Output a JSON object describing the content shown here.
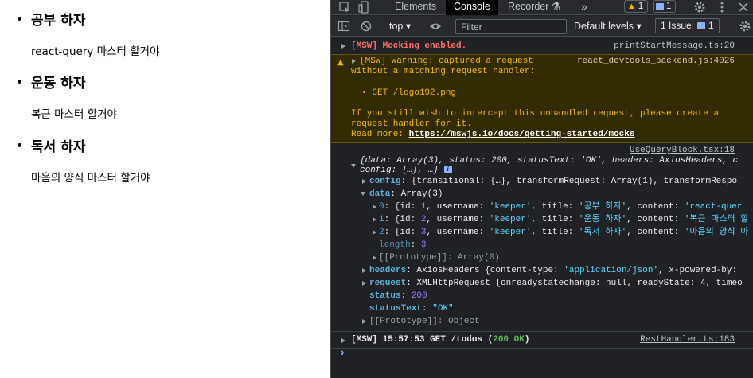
{
  "todos": [
    {
      "title": "공부 하자",
      "content": "react-query 마스터 할거야"
    },
    {
      "title": "운동 하자",
      "content": "복근 마스터 할거야"
    },
    {
      "title": "독서 하자",
      "content": "마음의 양식 마스터 할거야"
    }
  ],
  "devtools": {
    "tabs": [
      "Elements",
      "Console",
      "Recorder",
      "»"
    ],
    "active_tab": "Console",
    "warning_count": "1",
    "message_count": "1",
    "toolbar": {
      "context": "top ▾",
      "filter_placeholder": "Filter",
      "levels": "Default levels ▾",
      "issues_label": "1 Issue:",
      "issues_count": "1"
    },
    "console": {
      "mock_enabled": "[MSW] Mocking enabled.",
      "mock_enabled_src": "printStartMessage.ts:20",
      "warn_line1": "[MSW] Warning: captured a request",
      "warn_line2": "without a matching request handler:",
      "warn_src": "react_devtools_backend.js:4026",
      "warn_req": "  • GET /logo192.png",
      "warn_help1": "If you still wish to intercept this unhandled request, please create a",
      "warn_help2": "request handler for it.",
      "warn_readmore": "Read more: ",
      "warn_link": "https://mswjs.io/docs/getting-started/mocks",
      "log_src": "UseQueryBlock.tsx:18",
      "obj_summary1": "{data: Array(3), status: 200, statusText: 'OK', headers: AxiosHeaders, c",
      "obj_summary2": "config: {…}, …}",
      "info": "i",
      "config_key": "config",
      "config_val": ": {transitional: {…}, transformRequest: Array(1), transformRespo",
      "data_key": "data",
      "data_val": ": Array(3)",
      "items": [
        {
          "idx": "0",
          "id": "1",
          "username": "'keeper'",
          "title": "'공부 하자'",
          "content": "'react-quer"
        },
        {
          "idx": "1",
          "id": "2",
          "username": "'keeper'",
          "title": "'운동 하자'",
          "content": "'복근 마스터 할"
        },
        {
          "idx": "2",
          "id": "3",
          "username": "'keeper'",
          "title": "'독서 하자'",
          "content": "'마음의 양식 마"
        }
      ],
      "length_key": "length",
      "length_val": "3",
      "proto_array": "[[Prototype]]: Array(0)",
      "headers_key": "headers",
      "headers_val": ": AxiosHeaders {content-type: ",
      "headers_ct": "'application/json'",
      "headers_rest": ", x-powered-by: ",
      "request_key": "request",
      "request_val": ": XMLHttpRequest {onreadystatechange: null, readyState: 4, timeo",
      "status_key": "status",
      "status_val": "200",
      "statustext_key": "statusText",
      "statustext_val": "\"OK\"",
      "proto_object": "[[Prototype]]: Object",
      "msw_log_prefix": "[MSW] 15:57:53 GET /todos (",
      "msw_log_status": "200 OK",
      "msw_log_suffix": ")",
      "msw_log_src": "RestHandler.ts:183",
      "prompt": "›"
    }
  },
  "colors": {
    "devtools_bg": "#202124",
    "warning_bg": "#332b00",
    "error_red": "#ff6e6e",
    "string_cyan": "#5cd5fb",
    "number_purple": "#9980ff"
  }
}
